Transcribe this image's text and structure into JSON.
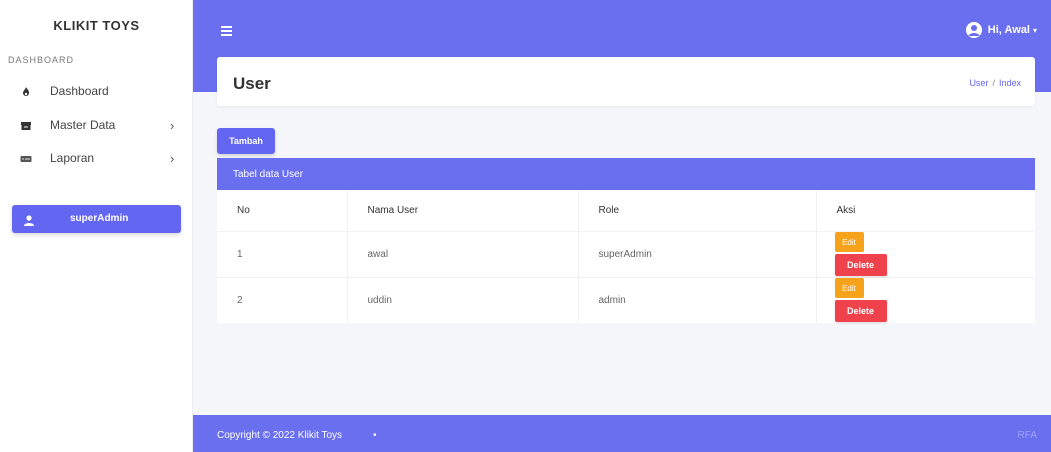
{
  "sidebar": {
    "brand": "KLIKIT TOYS",
    "section_label": "DASHBOARD",
    "items": [
      {
        "label": "Dashboard",
        "icon": "fire-icon"
      },
      {
        "label": "Master Data",
        "icon": "box-icon",
        "chevron": "›"
      },
      {
        "label": "Laporan",
        "icon": "report-icon",
        "chevron": "›"
      }
    ],
    "user_pill": {
      "label": "superAdmin",
      "icon": "user-icon"
    }
  },
  "topbar": {
    "menu_icon": "hamburger-icon",
    "greeting": "Hi, Awal",
    "caret": "▾"
  },
  "page": {
    "title": "User",
    "breadcrumb": [
      "User",
      "Index"
    ],
    "breadcrumb_sep": "/"
  },
  "add_button": "Tambah",
  "table": {
    "caption": "Tabel data User",
    "headers": [
      "No",
      "Nama User",
      "Role",
      "Aksi"
    ],
    "rows": [
      {
        "no": "1",
        "nama": "awal",
        "role": "superAdmin"
      },
      {
        "no": "2",
        "nama": "uddin",
        "role": "admin"
      }
    ],
    "edit_label": "Edit",
    "delete_label": "Delete"
  },
  "footer": {
    "copyright": "Copyright © 2022 Klikit Toys",
    "bullet": "•",
    "right": "RFA"
  },
  "colors": {
    "accent": "#6366f1",
    "edit": "#f6a21b",
    "delete": "#f0424c"
  }
}
